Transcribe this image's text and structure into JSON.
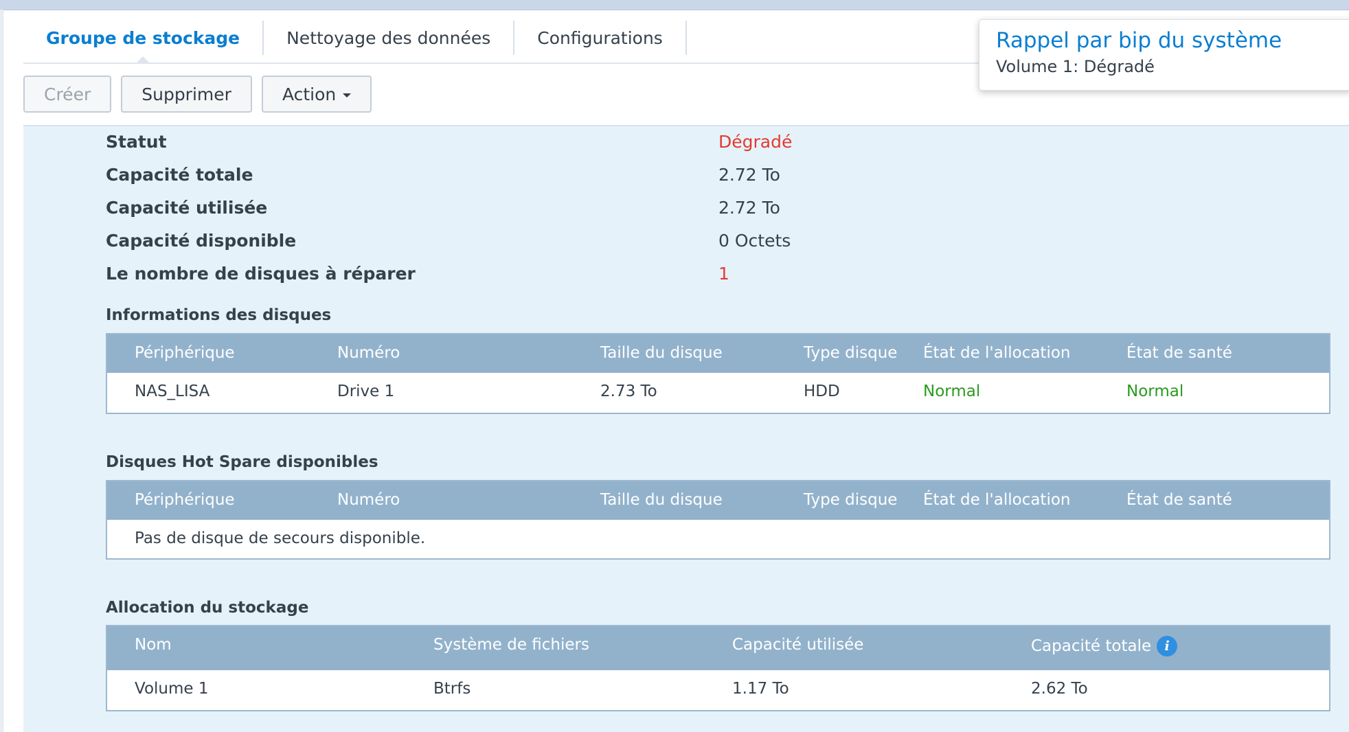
{
  "tabs": [
    {
      "label": "Groupe de stockage",
      "active": true
    },
    {
      "label": "Nettoyage des données",
      "active": false
    },
    {
      "label": "Configurations",
      "active": false
    }
  ],
  "toolbar": {
    "create": "Créer",
    "delete": "Supprimer",
    "action": "Action"
  },
  "notification": {
    "title": "Rappel par bip du système",
    "message": "Volume 1: Dégradé"
  },
  "summary": [
    {
      "label": "Statut",
      "value": "Dégradé",
      "color": "#e23b30"
    },
    {
      "label": "Capacité totale",
      "value": "2.72 To"
    },
    {
      "label": "Capacité utilisée",
      "value": "2.72 To"
    },
    {
      "label": "Capacité disponible",
      "value": "0 Octets"
    },
    {
      "label": "Le nombre de disques à réparer",
      "value": "1",
      "color": "#e23b30"
    }
  ],
  "disks": {
    "title": "Informations des disques",
    "columns": [
      "Périphérique",
      "Numéro",
      "Taille du disque",
      "Type disque",
      "État de l'allocation",
      "État de santé"
    ],
    "rows": [
      {
        "device": "NAS_LISA",
        "number": "Drive 1",
        "size": "2.73 To",
        "type": "HDD",
        "allocation": "Normal",
        "health": "Normal"
      }
    ]
  },
  "hotspare": {
    "title": "Disques Hot Spare disponibles",
    "columns": [
      "Périphérique",
      "Numéro",
      "Taille du disque",
      "Type disque",
      "État de l'allocation",
      "État de santé"
    ],
    "empty": "Pas de disque de secours disponible."
  },
  "allocation": {
    "title": "Allocation du stockage",
    "columns": [
      "Nom",
      "Système de fichiers",
      "Capacité utilisée",
      "Capacité totale"
    ],
    "rows": [
      {
        "name": "Volume 1",
        "filesystem": "Btrfs",
        "used": "1.17 To",
        "total": "2.62 To"
      }
    ]
  },
  "colors": {
    "accent": "#0b7ed1",
    "degraded": "#e23b30",
    "ok": "#2a9a1e",
    "table_header": "#92b2cc",
    "panel": "#e6f2fa"
  },
  "icons": {
    "info": "info-icon",
    "dropdown": "caret-down-icon"
  }
}
